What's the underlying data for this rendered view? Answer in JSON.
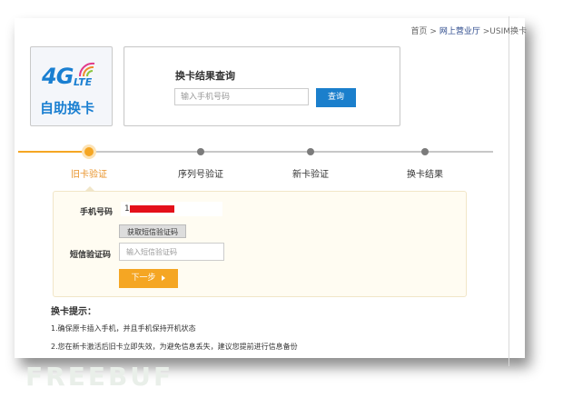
{
  "breadcrumb": {
    "home": "首页",
    "sep1": ">",
    "section": "网上营业厅",
    "current": ">USIM换卡"
  },
  "logo": {
    "big": "4G",
    "small": "LTE",
    "text": "自助换卡"
  },
  "query": {
    "title": "换卡结果查询",
    "placeholder": "输入手机号码",
    "button": "查询"
  },
  "steps": [
    {
      "label": "旧卡验证",
      "active": true
    },
    {
      "label": "序列号验证",
      "active": false
    },
    {
      "label": "新卡验证",
      "active": false
    },
    {
      "label": "换卡结果",
      "active": false
    }
  ],
  "form": {
    "phone_label": "手机号码",
    "phone_value": "1",
    "sms_button": "获取短信验证码",
    "sms_label": "短信验证码",
    "sms_placeholder": "输入短信验证码",
    "next_button": "下一步"
  },
  "tips": {
    "title": "换卡提示：",
    "items": [
      "1.确保原卡插入手机，并且手机保持开机状态",
      "2.您在新卡激活后旧卡立即失效，为避免信息丢失，建议您提前进行信息备份"
    ]
  },
  "watermark": "FREEBUF",
  "colors": {
    "accent": "#f5a623",
    "primary": "#1b7fcc",
    "mask": "#e4101a"
  }
}
